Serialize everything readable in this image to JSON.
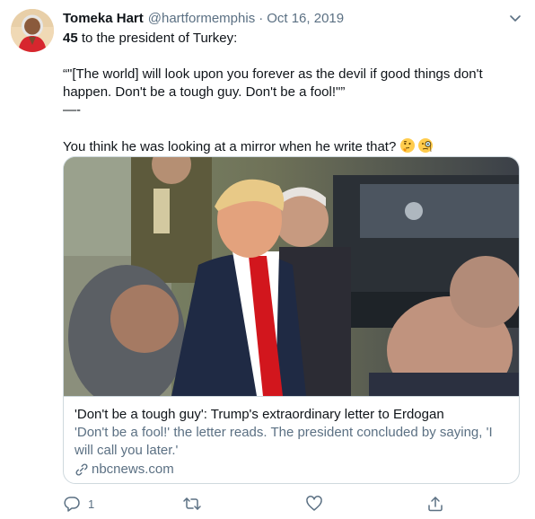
{
  "tweet": {
    "display_name": "Tomeka Hart",
    "handle": "@hartformemphis",
    "separator": "·",
    "date": "Oct 16, 2019",
    "lines": [
      {
        "bold": "45",
        "rest": " to the president of Turkey:"
      },
      {
        "text": "“\"[The world] will look upon you forever as the devil if good things don't happen. Don't be a tough guy. Don't be a fool!\"”"
      },
      {
        "text": "—-"
      },
      {
        "text": "You think he was looking at a mirror when he write that?"
      }
    ],
    "emojis": [
      "thinking-face",
      "face-with-monocle"
    ]
  },
  "card": {
    "title": "'Don't be a tough guy': Trump's extraordinary letter to Erdogan",
    "description": "'Don't be a fool!' the letter reads. The president concluded by saying, 'I will call you later.'",
    "domain": "nbcnews.com"
  },
  "actions": {
    "reply_count": "1",
    "retweet_count": "",
    "like_count": ""
  },
  "icons": {
    "reply": "reply-icon",
    "retweet": "retweet-icon",
    "like": "heart-icon",
    "share": "share-icon",
    "caret": "chevron-down-icon",
    "link": "link-icon"
  },
  "colors": {
    "text": "#0f1419",
    "secondary": "#5b7083",
    "border": "#cfd9de"
  }
}
